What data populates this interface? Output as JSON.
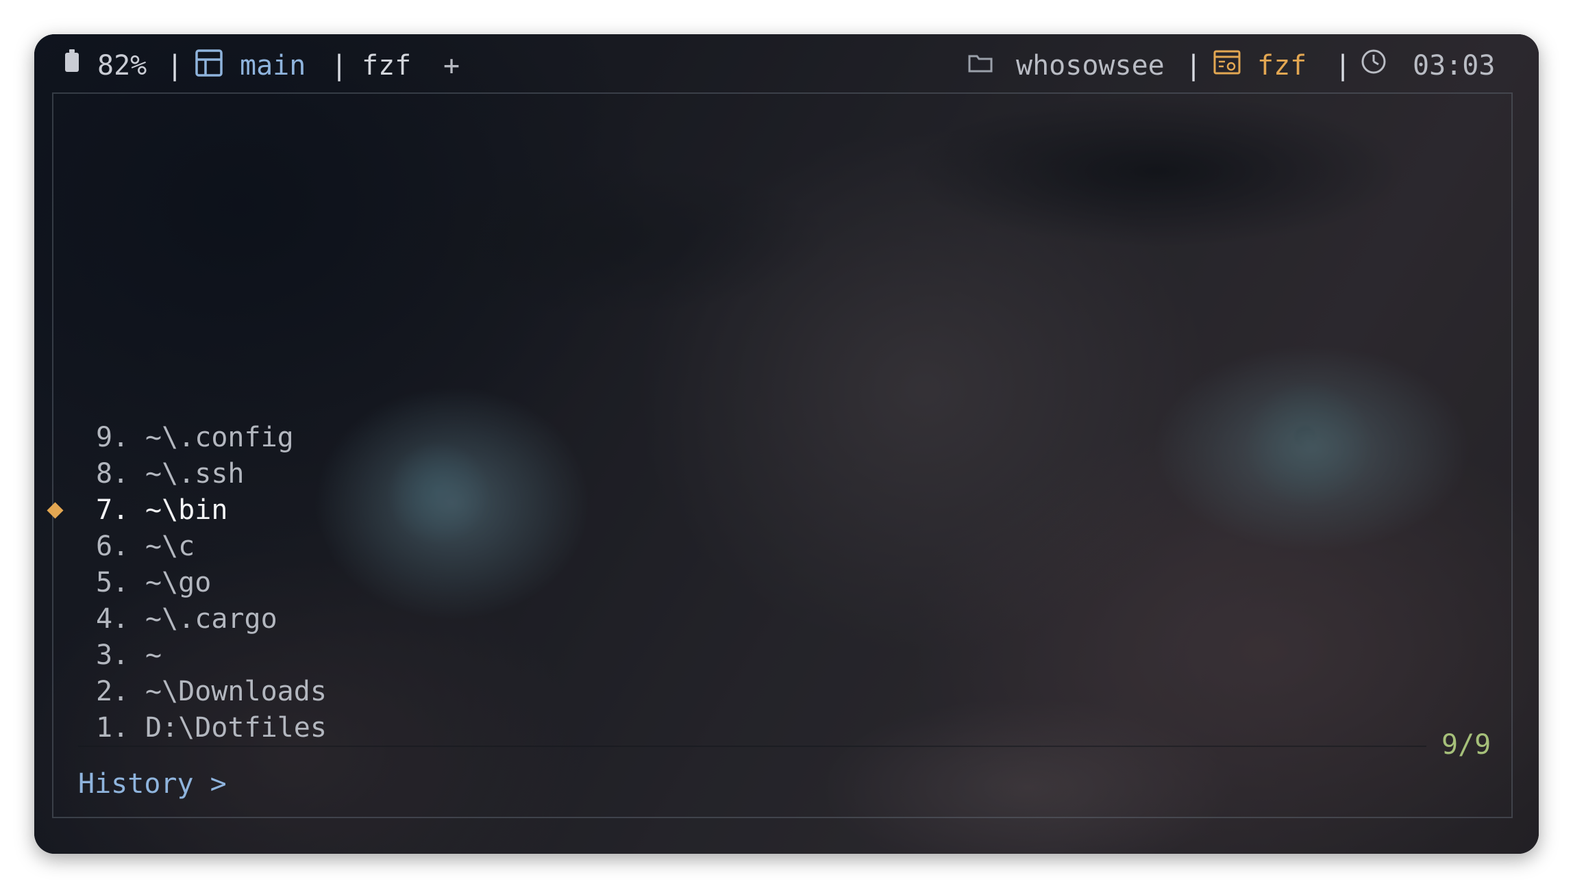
{
  "status_bar": {
    "battery": "82%",
    "separator": "|",
    "tabs": [
      {
        "label": "main",
        "active": true
      },
      {
        "label": "fzf",
        "active": false
      }
    ],
    "new_tab_label": "+",
    "user": "whosowsee",
    "process": "fzf",
    "time": "03:03",
    "icons": [
      "battery-icon",
      "tab-icon",
      "folder-icon",
      "terminal-app-icon",
      "clock-icon"
    ]
  },
  "fzf": {
    "items": [
      {
        "num": "9.",
        "path": "~\\.config"
      },
      {
        "num": "8.",
        "path": "~\\.ssh"
      },
      {
        "num": "7.",
        "path": "~\\bin"
      },
      {
        "num": "6.",
        "path": "~\\c"
      },
      {
        "num": "5.",
        "path": "~\\go"
      },
      {
        "num": "4.",
        "path": "~\\.cargo"
      },
      {
        "num": "3.",
        "path": "~"
      },
      {
        "num": "2.",
        "path": "~\\Downloads"
      },
      {
        "num": "1.",
        "path": "D:\\Dotfiles"
      }
    ],
    "selected_index": 2,
    "count": "9/9",
    "prompt": "History > "
  },
  "colors": {
    "accent_blue": "#8fb4dd",
    "accent_orange": "#e3a752",
    "accent_green": "#a6c07a",
    "text": "#b3b7bf"
  }
}
